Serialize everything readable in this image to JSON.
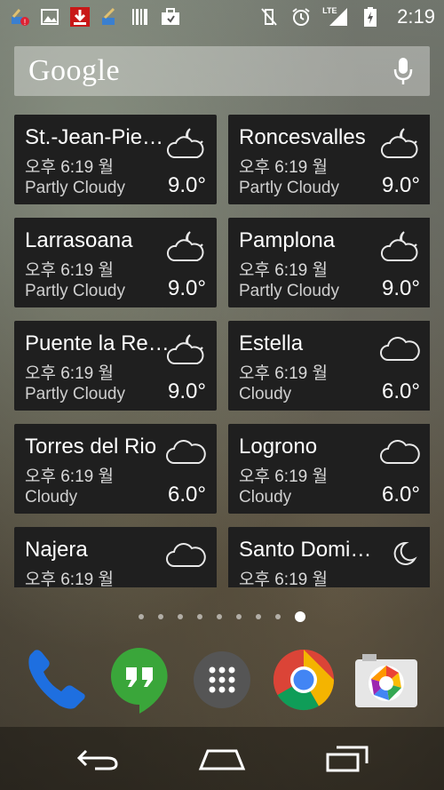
{
  "statusbar": {
    "left_icons": [
      "cleaner-alert-icon",
      "image-icon",
      "download-icon",
      "cleaner-icon",
      "barcode-icon",
      "briefcase-icon"
    ],
    "right_icons": [
      "vibrate-off-icon",
      "alarm-icon",
      "lte-signal-icon",
      "battery-charging-icon"
    ],
    "network": "LTE",
    "time": "2:19"
  },
  "search": {
    "logo": "Google",
    "mic_icon": "mic-icon"
  },
  "weather_cards": [
    {
      "city": "St.-Jean-Pie…",
      "time": "오후 6:19 월",
      "condition": "Partly Cloudy",
      "temp": "9.0°",
      "icon": "partly-cloudy-night-icon"
    },
    {
      "city": "Roncesvalles",
      "time": "오후 6:19 월",
      "condition": "Partly Cloudy",
      "temp": "9.0°",
      "icon": "partly-cloudy-night-icon"
    },
    {
      "city": "Larrasoana",
      "time": "오후 6:19 월",
      "condition": "Partly Cloudy",
      "temp": "9.0°",
      "icon": "partly-cloudy-night-icon"
    },
    {
      "city": "Pamplona",
      "time": "오후 6:19 월",
      "condition": "Partly Cloudy",
      "temp": "9.0°",
      "icon": "partly-cloudy-night-icon"
    },
    {
      "city": "Puente la Re…",
      "time": "오후 6:19 월",
      "condition": "Partly Cloudy",
      "temp": "9.0°",
      "icon": "partly-cloudy-night-icon"
    },
    {
      "city": "Estella",
      "time": "오후 6:19 월",
      "condition": "Cloudy",
      "temp": "6.0°",
      "icon": "cloud-icon"
    },
    {
      "city": "Torres del Rio",
      "time": "오후 6:19 월",
      "condition": "Cloudy",
      "temp": "6.0°",
      "icon": "cloud-icon"
    },
    {
      "city": "Logrono",
      "time": "오후 6:19 월",
      "condition": "Cloudy",
      "temp": "6.0°",
      "icon": "cloud-icon"
    },
    {
      "city": "Najera",
      "time": "오후 6:19 월",
      "condition": "",
      "temp": "",
      "icon": "cloud-icon"
    },
    {
      "city": "Santo Domi…",
      "time": "오후 6:19 월",
      "condition": "",
      "temp": "",
      "icon": "moon-icon"
    }
  ],
  "page_indicator": {
    "count": 9,
    "active_index": 8
  },
  "dock": [
    "phone-icon",
    "hangouts-icon",
    "app-drawer-icon",
    "chrome-icon",
    "camera-icon"
  ],
  "navbar": [
    "back-icon",
    "home-icon",
    "recents-icon"
  ]
}
